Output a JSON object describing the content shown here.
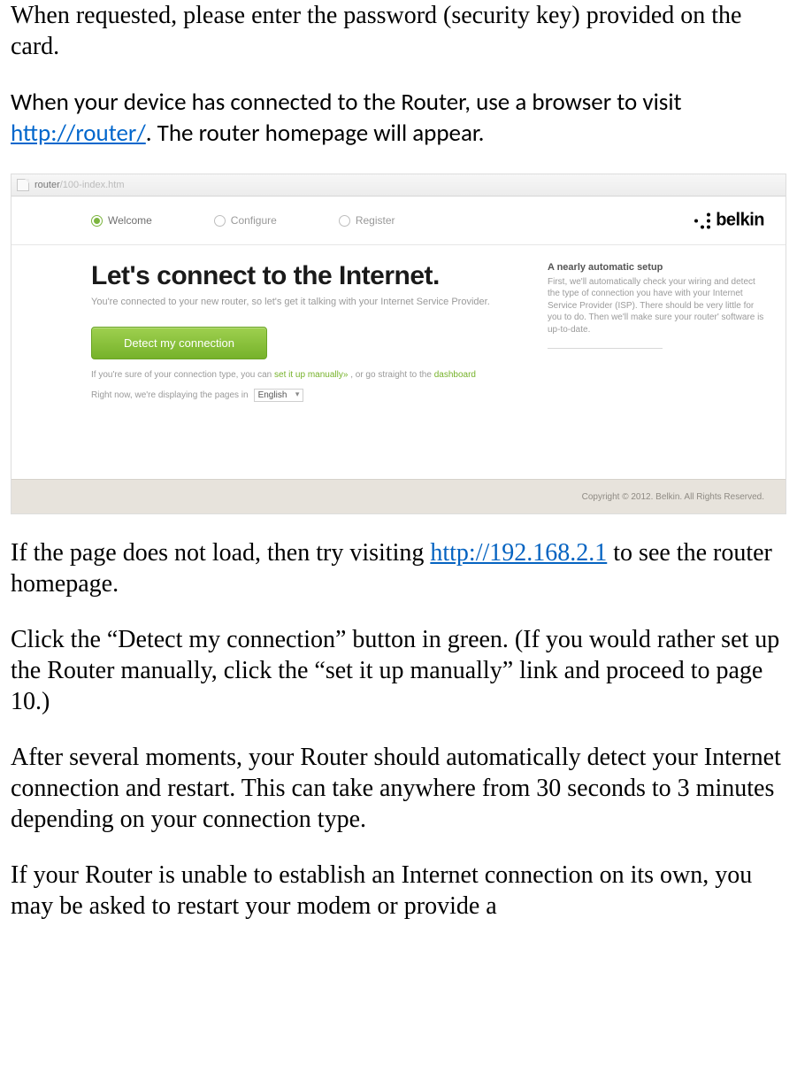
{
  "doc": {
    "para1": "When requested, please enter the password (security key) provided on the card.",
    "para2_prefix": "When your device has connected to the Router, use a browser to visit ",
    "para2_link_text": "http://router/",
    "para2_mid": ". The ",
    "para2_emph": "router homepage",
    "para2_suffix": " will appear.",
    "para3_prefix": "If the page does not load, then try visiting ",
    "para3_link_text": "http://192.168.2.1",
    "para3_suffix": " to see the router homepage.",
    "para4": "Click the “Detect my connection” button in green. (If you would rather set up the Router manually, click the “set it up manually” link and proceed to page 10.)",
    "para5": "After several moments, your Router should automatically detect your Internet connection and restart. This can take anywhere from 30 seconds to 3 minutes depending on your connection type.",
    "para6": "If your Router is unable to establish an Internet connection on its own, you may be asked to restart your modem or provide a"
  },
  "screenshot": {
    "url_host": "router",
    "url_path": "/100-index.htm",
    "tabs": {
      "welcome": "Welcome",
      "configure": "Configure",
      "register": "Register"
    },
    "brand": "belkin",
    "headline": "Let's connect to the Internet.",
    "sub": "You're connected to your new router, so let's get it talking with your Internet Service Provider.",
    "button": "Detect my connection",
    "hint_prefix": "If you're sure of your connection type, you can ",
    "hint_link1": "set it up manually»",
    "hint_mid": " , or go straight to the ",
    "hint_link2": "dashboard",
    "lang_label": "Right now, we're displaying the pages in",
    "lang_value": "English",
    "right": {
      "title": "A nearly automatic setup",
      "body": "First, we'll automatically check your wiring and detect the type of connection you have with your Internet Service Provider (ISP). There should be very little for you to do. Then we'll make sure your router' software is up-to-date."
    },
    "copyright": "Copyright © 2012. Belkin. All Rights Reserved."
  }
}
